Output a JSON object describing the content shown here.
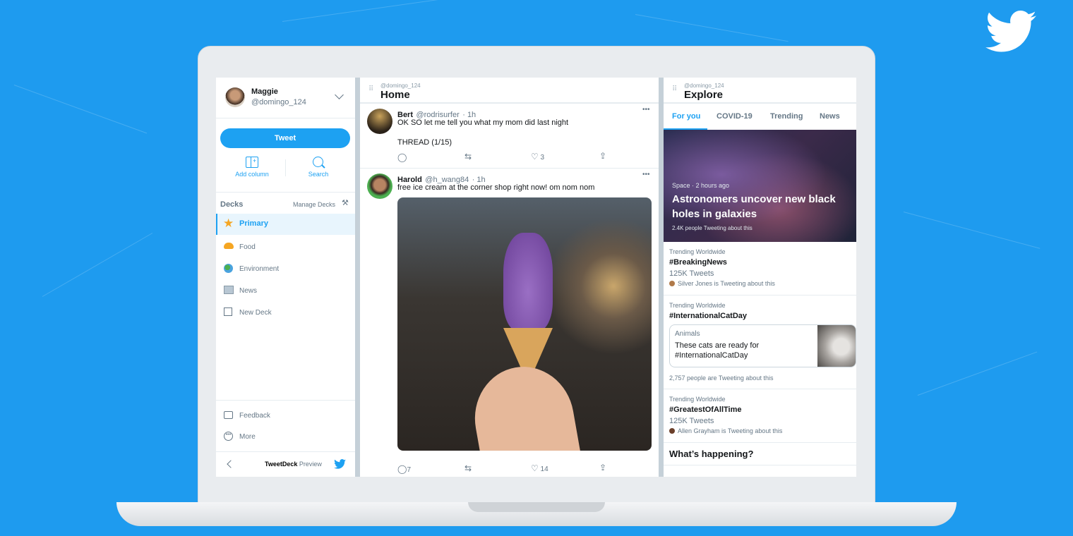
{
  "colors": {
    "background": "#1e9bef",
    "accent": "#1da1f2"
  },
  "sidebar": {
    "user": {
      "name": "Maggie",
      "handle": "@domingo_124"
    },
    "tweet_button": "Tweet",
    "add_column": "Add column",
    "search": "Search",
    "decks_label": "Decks",
    "manage_decks": "Manage Decks",
    "decks": [
      {
        "label": "Primary",
        "icon": "star-icon",
        "active": true
      },
      {
        "label": "Food",
        "icon": "taco-icon"
      },
      {
        "label": "Environment",
        "icon": "globe-icon"
      },
      {
        "label": "News",
        "icon": "newspaper-icon"
      },
      {
        "label": "New Deck",
        "icon": "new-deck-icon"
      }
    ],
    "feedback": "Feedback",
    "more": "More",
    "footer": {
      "brand": "TweetDeck",
      "suffix": "Preview"
    }
  },
  "home": {
    "account": "@domingo_124",
    "title": "Home",
    "tweets": [
      {
        "name": "Bert",
        "handle": "@rodrisurfer",
        "time": "· 1h",
        "text": "OK SO let me tell you what my mom did last night",
        "text2": "THREAD (1/15)",
        "replies": "",
        "likes": "3"
      },
      {
        "name": "Harold",
        "handle": "@h_wang84",
        "time": "· 1h",
        "text": "free ice cream at the corner shop right now! om nom nom",
        "replies": "7",
        "likes": "14"
      }
    ]
  },
  "explore": {
    "account": "@domingo_124",
    "title": "Explore",
    "tabs": [
      {
        "label": "For you",
        "active": true
      },
      {
        "label": "COVID-19"
      },
      {
        "label": "Trending"
      },
      {
        "label": "News"
      }
    ],
    "hero": {
      "meta": "Space · 2 hours ago",
      "headline": "Astronomers uncover new black holes in galaxies",
      "count": "2.4K people Tweeting about this"
    },
    "trends": [
      {
        "context": "Trending Worldwide",
        "tag": "#BreakingNews",
        "count": "125K Tweets",
        "social": "Silver Jones is Tweeting about this"
      },
      {
        "context": "Trending Worldwide",
        "tag": "#InternationalCatDay",
        "card_category": "Animals",
        "card_text": "These cats are ready for #InternationalCatDay",
        "social": "2,757 people are Tweeting about this"
      },
      {
        "context": "Trending Worldwide",
        "tag": "#GreatestOfAllTime",
        "count": "125K Tweets",
        "social": "Allen Grayham is Tweeting about this"
      }
    ],
    "section": "What’s happening?"
  }
}
